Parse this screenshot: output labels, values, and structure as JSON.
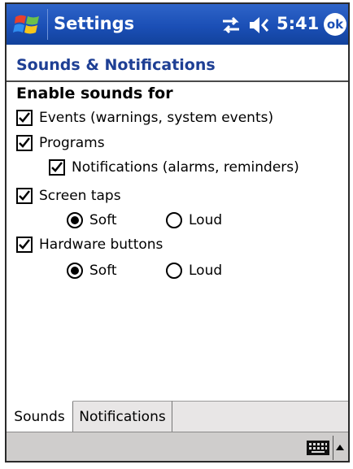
{
  "titlebar": {
    "app_title": "Settings",
    "time": "5:41",
    "ok_label": "ok",
    "icons": [
      "windows-start-icon",
      "connectivity-icon",
      "speaker-volume-icon"
    ],
    "color": "#1b4fb6"
  },
  "page": {
    "heading": "Sounds & Notifications",
    "heading_color": "#1e3f94"
  },
  "sounds": {
    "section_label": "Enable sounds for",
    "events": {
      "label": "Events (warnings, system events)",
      "checked": true
    },
    "programs": {
      "label": "Programs",
      "checked": true
    },
    "notifications": {
      "label": "Notifications (alarms, reminders)",
      "checked": true
    },
    "screen_taps": {
      "label": "Screen taps",
      "checked": true,
      "soft_label": "Soft",
      "loud_label": "Loud",
      "selected": "Soft"
    },
    "hardware_buttons": {
      "label": "Hardware buttons",
      "checked": true,
      "soft_label": "Soft",
      "loud_label": "Loud",
      "selected": "Soft"
    }
  },
  "tabs": [
    {
      "label": "Sounds",
      "active": true
    },
    {
      "label": "Notifications",
      "active": false
    }
  ],
  "bottombar": {
    "icons": [
      "keyboard-icon",
      "input-menu-arrow-icon"
    ]
  }
}
